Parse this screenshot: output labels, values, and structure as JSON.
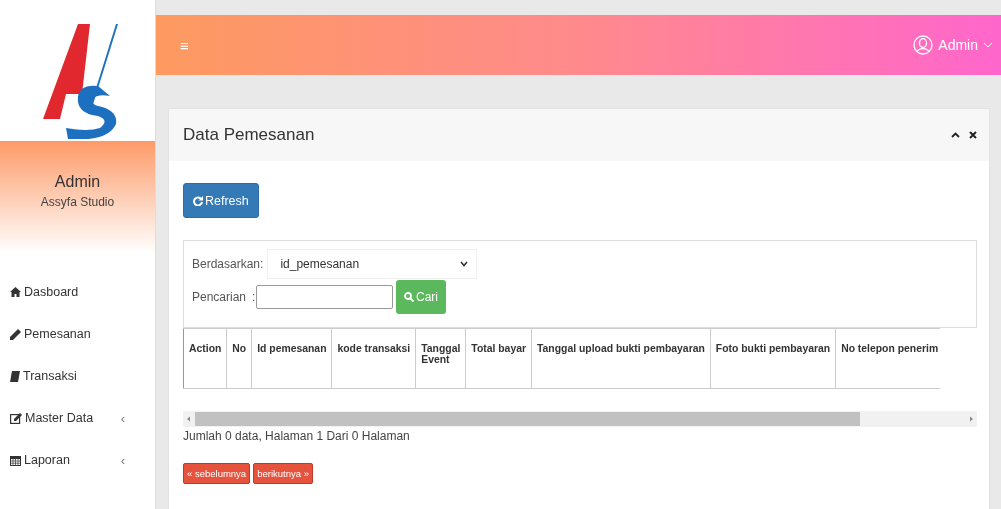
{
  "sidebar": {
    "profile": {
      "name": "Admin",
      "subtitle": "Assyfa Studio"
    },
    "items": [
      {
        "label": "Dasboard"
      },
      {
        "label": "Pemesanan"
      },
      {
        "label": "Transaksi"
      },
      {
        "label": "Master Data",
        "chevron": "‹"
      },
      {
        "label": "Laporan",
        "chevron": "‹"
      }
    ]
  },
  "topbar": {
    "menu_glyph": "≡",
    "user": "Admin"
  },
  "panel": {
    "title": "Data Pemesanan",
    "refresh_button": "Refresh",
    "filter": {
      "by_label": "Berdasarkan:",
      "by_value": "id_pemesanan",
      "search_label": "Pencarian",
      "search_sep": ":",
      "search_button": "Cari"
    },
    "table": {
      "columns": [
        "Action",
        "No",
        "Id pemesanan",
        "kode transaksi",
        "Tanggal Event",
        "Total bayar",
        "Tanggal upload bukti pembayaran",
        "Foto bukti pembayaran",
        "No telepon penerim"
      ]
    },
    "summary": "Jumlah 0 data, Halaman 1 Dari 0 Halaman",
    "pager": [
      "« sebelumnya",
      "berikutnya »"
    ]
  }
}
